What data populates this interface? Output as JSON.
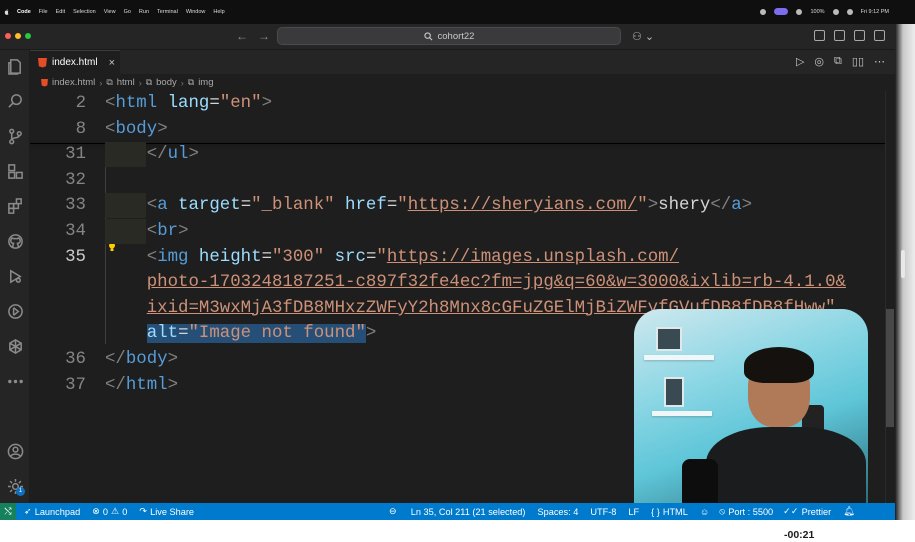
{
  "menubar": {
    "app_name": "Code",
    "items": [
      "File",
      "Edit",
      "Selection",
      "View",
      "Go",
      "Run",
      "Terminal",
      "Window",
      "Help"
    ],
    "battery": "100%",
    "clock": "Fri 9:12 PM"
  },
  "titlebar": {
    "search_text": "cohort22",
    "back_glyph": "←",
    "forward_glyph": "→",
    "copilot_glyph": "⚇ ⌄"
  },
  "tab": {
    "filename": "index.html",
    "close_glyph": "×",
    "icon": "html5-icon"
  },
  "editor_actions": [
    "▷",
    "◎",
    "⧉",
    "▯▯",
    "⋯"
  ],
  "breadcrumb": {
    "file": "index.html",
    "crumbs": [
      "html",
      "body",
      "img"
    ],
    "sep": "›"
  },
  "code": {
    "lines": [
      {
        "num": "2",
        "tokens": [
          {
            "t": "<",
            "c": "br"
          },
          {
            "t": "html",
            "c": "tag"
          },
          {
            "t": " lang",
            "c": "attr"
          },
          {
            "t": "=",
            "c": "plain"
          },
          {
            "t": "\"en\"",
            "c": "str"
          },
          {
            "t": ">",
            "c": "br"
          }
        ]
      },
      {
        "num": "8",
        "tokens": [
          {
            "t": "<",
            "c": "br"
          },
          {
            "t": "body",
            "c": "tag"
          },
          {
            "t": ">",
            "c": "br"
          }
        ]
      },
      {
        "num": "31",
        "tokens": [
          {
            "t": "    ",
            "c": "plain"
          },
          {
            "t": "</",
            "c": "br"
          },
          {
            "t": "ul",
            "c": "tag"
          },
          {
            "t": ">",
            "c": "br"
          }
        ]
      },
      {
        "num": "32",
        "tokens": []
      },
      {
        "num": "33",
        "tokens": [
          {
            "t": "    ",
            "c": "plain"
          },
          {
            "t": "<",
            "c": "br"
          },
          {
            "t": "a",
            "c": "tag"
          },
          {
            "t": " target",
            "c": "attr"
          },
          {
            "t": "=",
            "c": "plain"
          },
          {
            "t": "\"_blank\"",
            "c": "str"
          },
          {
            "t": " href",
            "c": "attr"
          },
          {
            "t": "=",
            "c": "plain"
          },
          {
            "t": "\"",
            "c": "str"
          },
          {
            "t": "https://sheryians.com/",
            "c": "url"
          },
          {
            "t": "\"",
            "c": "str"
          },
          {
            "t": ">",
            "c": "br"
          },
          {
            "t": "shery",
            "c": "plain"
          },
          {
            "t": "</",
            "c": "br"
          },
          {
            "t": "a",
            "c": "tag"
          },
          {
            "t": ">",
            "c": "br"
          }
        ]
      },
      {
        "num": "34",
        "tokens": [
          {
            "t": "    ",
            "c": "plain"
          },
          {
            "t": "<",
            "c": "br"
          },
          {
            "t": "br",
            "c": "tag"
          },
          {
            "t": ">",
            "c": "br"
          }
        ]
      },
      {
        "num": "35",
        "tokens": [
          {
            "t": "    ",
            "c": "plain"
          },
          {
            "t": "<",
            "c": "br"
          },
          {
            "t": "img",
            "c": "tag"
          },
          {
            "t": " height",
            "c": "attr"
          },
          {
            "t": "=",
            "c": "plain"
          },
          {
            "t": "\"300\"",
            "c": "str"
          },
          {
            "t": " src",
            "c": "attr"
          },
          {
            "t": "=",
            "c": "plain"
          },
          {
            "t": "\"",
            "c": "str"
          },
          {
            "t": "https://images.unsplash.com/",
            "c": "url"
          }
        ]
      },
      {
        "num": "",
        "tokens": [
          {
            "t": "    ",
            "c": "plain"
          },
          {
            "t": "photo-1703248187251-c897f32fe4ec?fm=jpg&q=60&w=3000&ixlib=rb-4.1.0&",
            "c": "url"
          }
        ]
      },
      {
        "num": "",
        "tokens": [
          {
            "t": "    ",
            "c": "plain"
          },
          {
            "t": "ixid=M3wxMjA3fDB8MHxzZWFyY2h8Mnx8cGFuZGElMjBiZWFyfGVufDB8fDB8fHww",
            "c": "url"
          },
          {
            "t": "\"",
            "c": "str"
          }
        ]
      },
      {
        "num": "",
        "tokens": [
          {
            "t": "    ",
            "c": "plain"
          },
          {
            "t": "alt",
            "c": "attr",
            "sel": true
          },
          {
            "t": "=",
            "c": "plain",
            "sel": true
          },
          {
            "t": "\"Image not found\"",
            "c": "str",
            "sel": true
          },
          {
            "t": ">",
            "c": "br"
          }
        ]
      },
      {
        "num": "36",
        "tokens": [
          {
            "t": "</",
            "c": "br"
          },
          {
            "t": "body",
            "c": "tag"
          },
          {
            "t": ">",
            "c": "br"
          }
        ]
      },
      {
        "num": "37",
        "tokens": [
          {
            "t": "</",
            "c": "br"
          },
          {
            "t": "html",
            "c": "tag"
          },
          {
            "t": ">",
            "c": "br"
          }
        ]
      }
    ]
  },
  "statusbar": {
    "remote_glyph": "⤭",
    "launchpad": "Launchpad",
    "errors": "0",
    "warnings": "0",
    "live_share": "Live Share",
    "cursor": "Ln 35, Col 211 (21 selected)",
    "spaces": "Spaces: 4",
    "encoding": "UTF-8",
    "eol": "LF",
    "language": "HTML",
    "port": "Port : 5500",
    "prettier": "Prettier",
    "color": "#007acc"
  },
  "activity_badge": "1",
  "video_timer": "-00:21"
}
